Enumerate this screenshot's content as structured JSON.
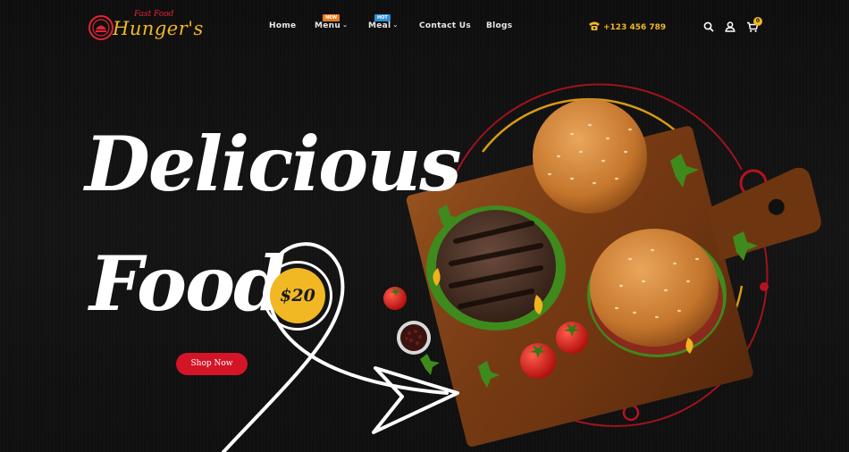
{
  "logo": {
    "subtitle": "Fast Food",
    "name": "Hunger's"
  },
  "nav": {
    "items": [
      {
        "label": "Home",
        "has_dropdown": false,
        "badge": ""
      },
      {
        "label": "Menu",
        "has_dropdown": true,
        "badge": "NEW"
      },
      {
        "label": "Meal",
        "has_dropdown": true,
        "badge": "HOT"
      },
      {
        "label": "Contact Us",
        "has_dropdown": false,
        "badge": ""
      },
      {
        "label": "Blogs",
        "has_dropdown": false,
        "badge": ""
      }
    ],
    "chevron": "⌄"
  },
  "contact": {
    "phone": "+123 456 789",
    "icon": "phone-icon"
  },
  "header_icons": [
    "search-icon",
    "user-icon",
    "cart-icon"
  ],
  "cart": {
    "count": "0"
  },
  "hero": {
    "line1": "Delicious",
    "line2": "Food",
    "price": "$20",
    "cta_label": "Shop Now"
  },
  "colors": {
    "accent_yellow": "#f1b824",
    "accent_red": "#d31527",
    "background": "#101010",
    "badge_new": "#e87a1c",
    "badge_hot": "#2e8fd6"
  }
}
